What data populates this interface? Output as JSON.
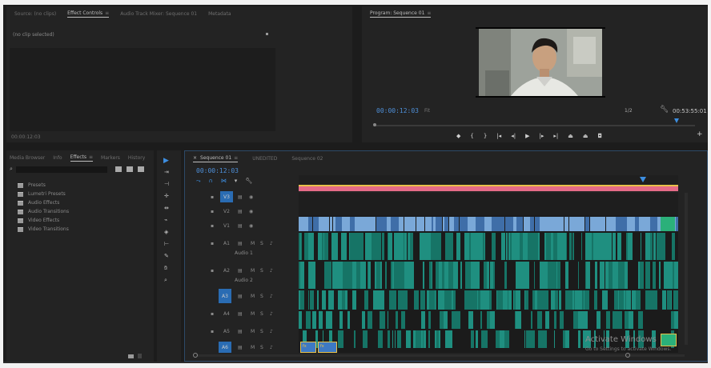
{
  "source_panel": {
    "tabs": [
      "Source: (no clips)",
      "Effect Controls",
      "Audio Track Mixer: Sequence 01",
      "Metadata"
    ],
    "active_tab": 1,
    "info_text": "(no clip selected)",
    "footer_timecode": "00:00:12:03"
  },
  "program_monitor": {
    "title": "Program: Sequence 01",
    "current_timecode": "00:00:12:03",
    "fit_label": "Fit",
    "resolution": "1/2",
    "duration": "00:53:55:01",
    "controls": [
      "marker-icon",
      "in-point-icon",
      "out-point-icon",
      "go-to-in-icon",
      "step-back-icon",
      "play-icon",
      "step-forward-icon",
      "go-to-out-icon",
      "lift-icon",
      "extract-icon",
      "export-frame-icon"
    ],
    "add_label": "+"
  },
  "effects_panel": {
    "tabs": [
      "Media Browser",
      "Info",
      "Effects",
      "Markers",
      "History"
    ],
    "active_tab": 2,
    "search_placeholder": "",
    "folders": [
      "Presets",
      "Lumetri Presets",
      "Audio Effects",
      "Audio Transitions",
      "Video Effects",
      "Video Transitions"
    ]
  },
  "tools": [
    "selection-tool",
    "track-select-tool",
    "ripple-edit-tool",
    "rolling-edit-tool",
    "rate-stretch-tool",
    "razor-tool",
    "slip-tool",
    "slide-tool",
    "pen-tool",
    "hand-tool",
    "zoom-tool"
  ],
  "timeline": {
    "tabs": [
      "Sequence 01",
      "UNEDITED",
      "Sequence 02"
    ],
    "active_tab": 0,
    "timecode": "00:00:12:03",
    "tracks": [
      {
        "name": "V3"
      },
      {
        "name": "V2"
      },
      {
        "name": "V1"
      },
      {
        "name": "A1",
        "sub": "Audio 1"
      },
      {
        "name": "A2",
        "sub": "Audio 2"
      },
      {
        "name": "A3"
      },
      {
        "name": "A4"
      },
      {
        "name": "A5"
      },
      {
        "name": "A6"
      }
    ],
    "track_buttons": {
      "mute": "M",
      "solo": "S"
    },
    "small_clip_label": "fx"
  },
  "watermark": {
    "title": "Activate Windows",
    "subtitle": "Go to Settings to activate Windows."
  },
  "colors": {
    "accent_blue": "#3d8ee0",
    "video_clip": "#7aa8d8",
    "audio_clip": "#1f8f80",
    "work_area": "#e56b87",
    "in_out": "#e8c14a"
  }
}
